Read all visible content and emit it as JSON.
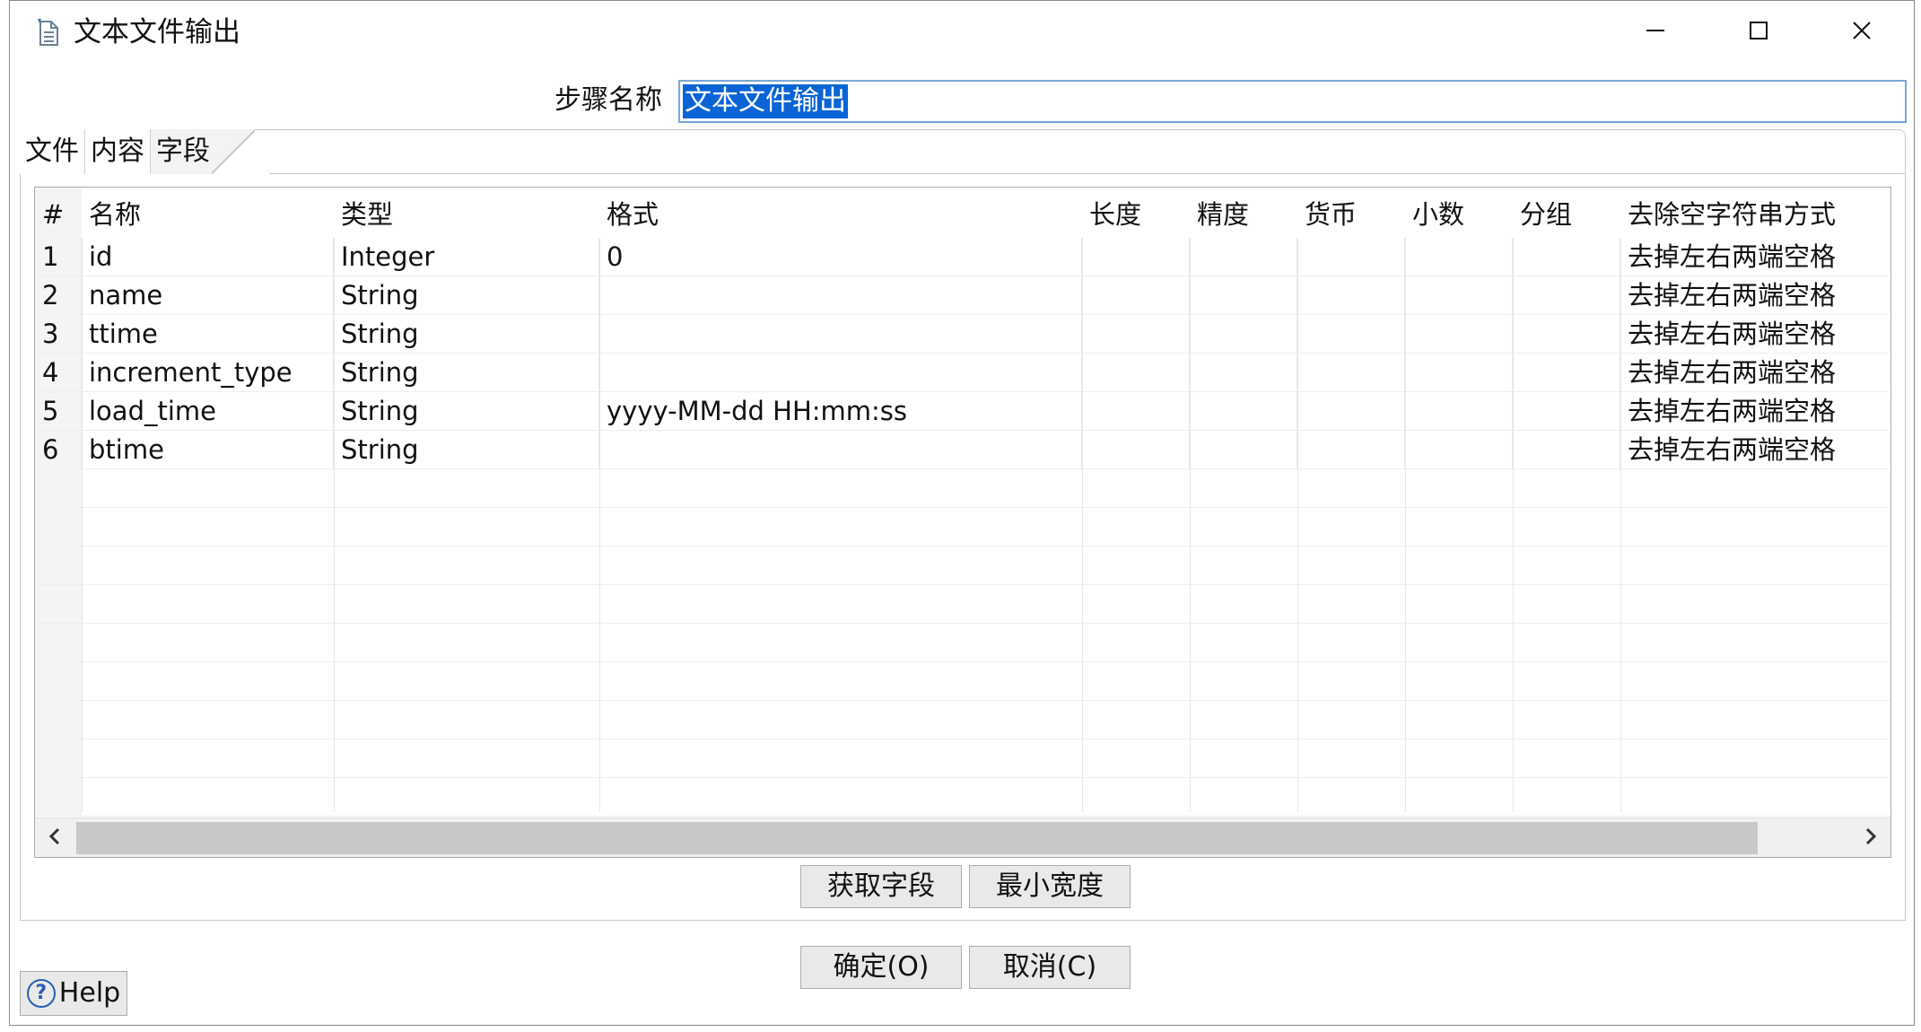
{
  "window": {
    "title": "文本文件输出",
    "icons": {
      "app": "document-icon",
      "minimize": "minimize-icon",
      "maximize": "maximize-icon",
      "close": "close-icon"
    }
  },
  "step": {
    "label": "步骤名称",
    "value": "文本文件输出"
  },
  "tabs": [
    {
      "label": "文件",
      "active": false
    },
    {
      "label": "内容",
      "active": false
    },
    {
      "label": "字段",
      "active": true
    }
  ],
  "grid": {
    "headers": {
      "num": "#",
      "name": "名称",
      "type": "类型",
      "format": "格式",
      "length": "长度",
      "precision": "精度",
      "currency": "货币",
      "decimal": "小数",
      "group": "分组",
      "trim": "去除空字符串方式"
    },
    "rows": [
      {
        "num": "1",
        "name": "id",
        "type": "Integer",
        "format": "0",
        "length": "",
        "precision": "",
        "currency": "",
        "decimal": "",
        "group": "",
        "trim": "去掉左右两端空格"
      },
      {
        "num": "2",
        "name": "name",
        "type": "String",
        "format": "",
        "length": "",
        "precision": "",
        "currency": "",
        "decimal": "",
        "group": "",
        "trim": "去掉左右两端空格"
      },
      {
        "num": "3",
        "name": "ttime",
        "type": "String",
        "format": "",
        "length": "",
        "precision": "",
        "currency": "",
        "decimal": "",
        "group": "",
        "trim": "去掉左右两端空格"
      },
      {
        "num": "4",
        "name": "increment_type",
        "type": "String",
        "format": "",
        "length": "",
        "precision": "",
        "currency": "",
        "decimal": "",
        "group": "",
        "trim": "去掉左右两端空格"
      },
      {
        "num": "5",
        "name": "load_time",
        "type": "String",
        "format": "yyyy-MM-dd HH:mm:ss",
        "length": "",
        "precision": "",
        "currency": "",
        "decimal": "",
        "group": "",
        "trim": "去掉左右两端空格"
      },
      {
        "num": "6",
        "name": "btime",
        "type": "String",
        "format": "",
        "length": "",
        "precision": "",
        "currency": "",
        "decimal": "",
        "group": "",
        "trim": "去掉左右两端空格"
      }
    ]
  },
  "buttons": {
    "get_fields": "获取字段",
    "min_width": "最小宽度",
    "ok": "确定(O)",
    "cancel": "取消(C)",
    "help": "Help"
  }
}
